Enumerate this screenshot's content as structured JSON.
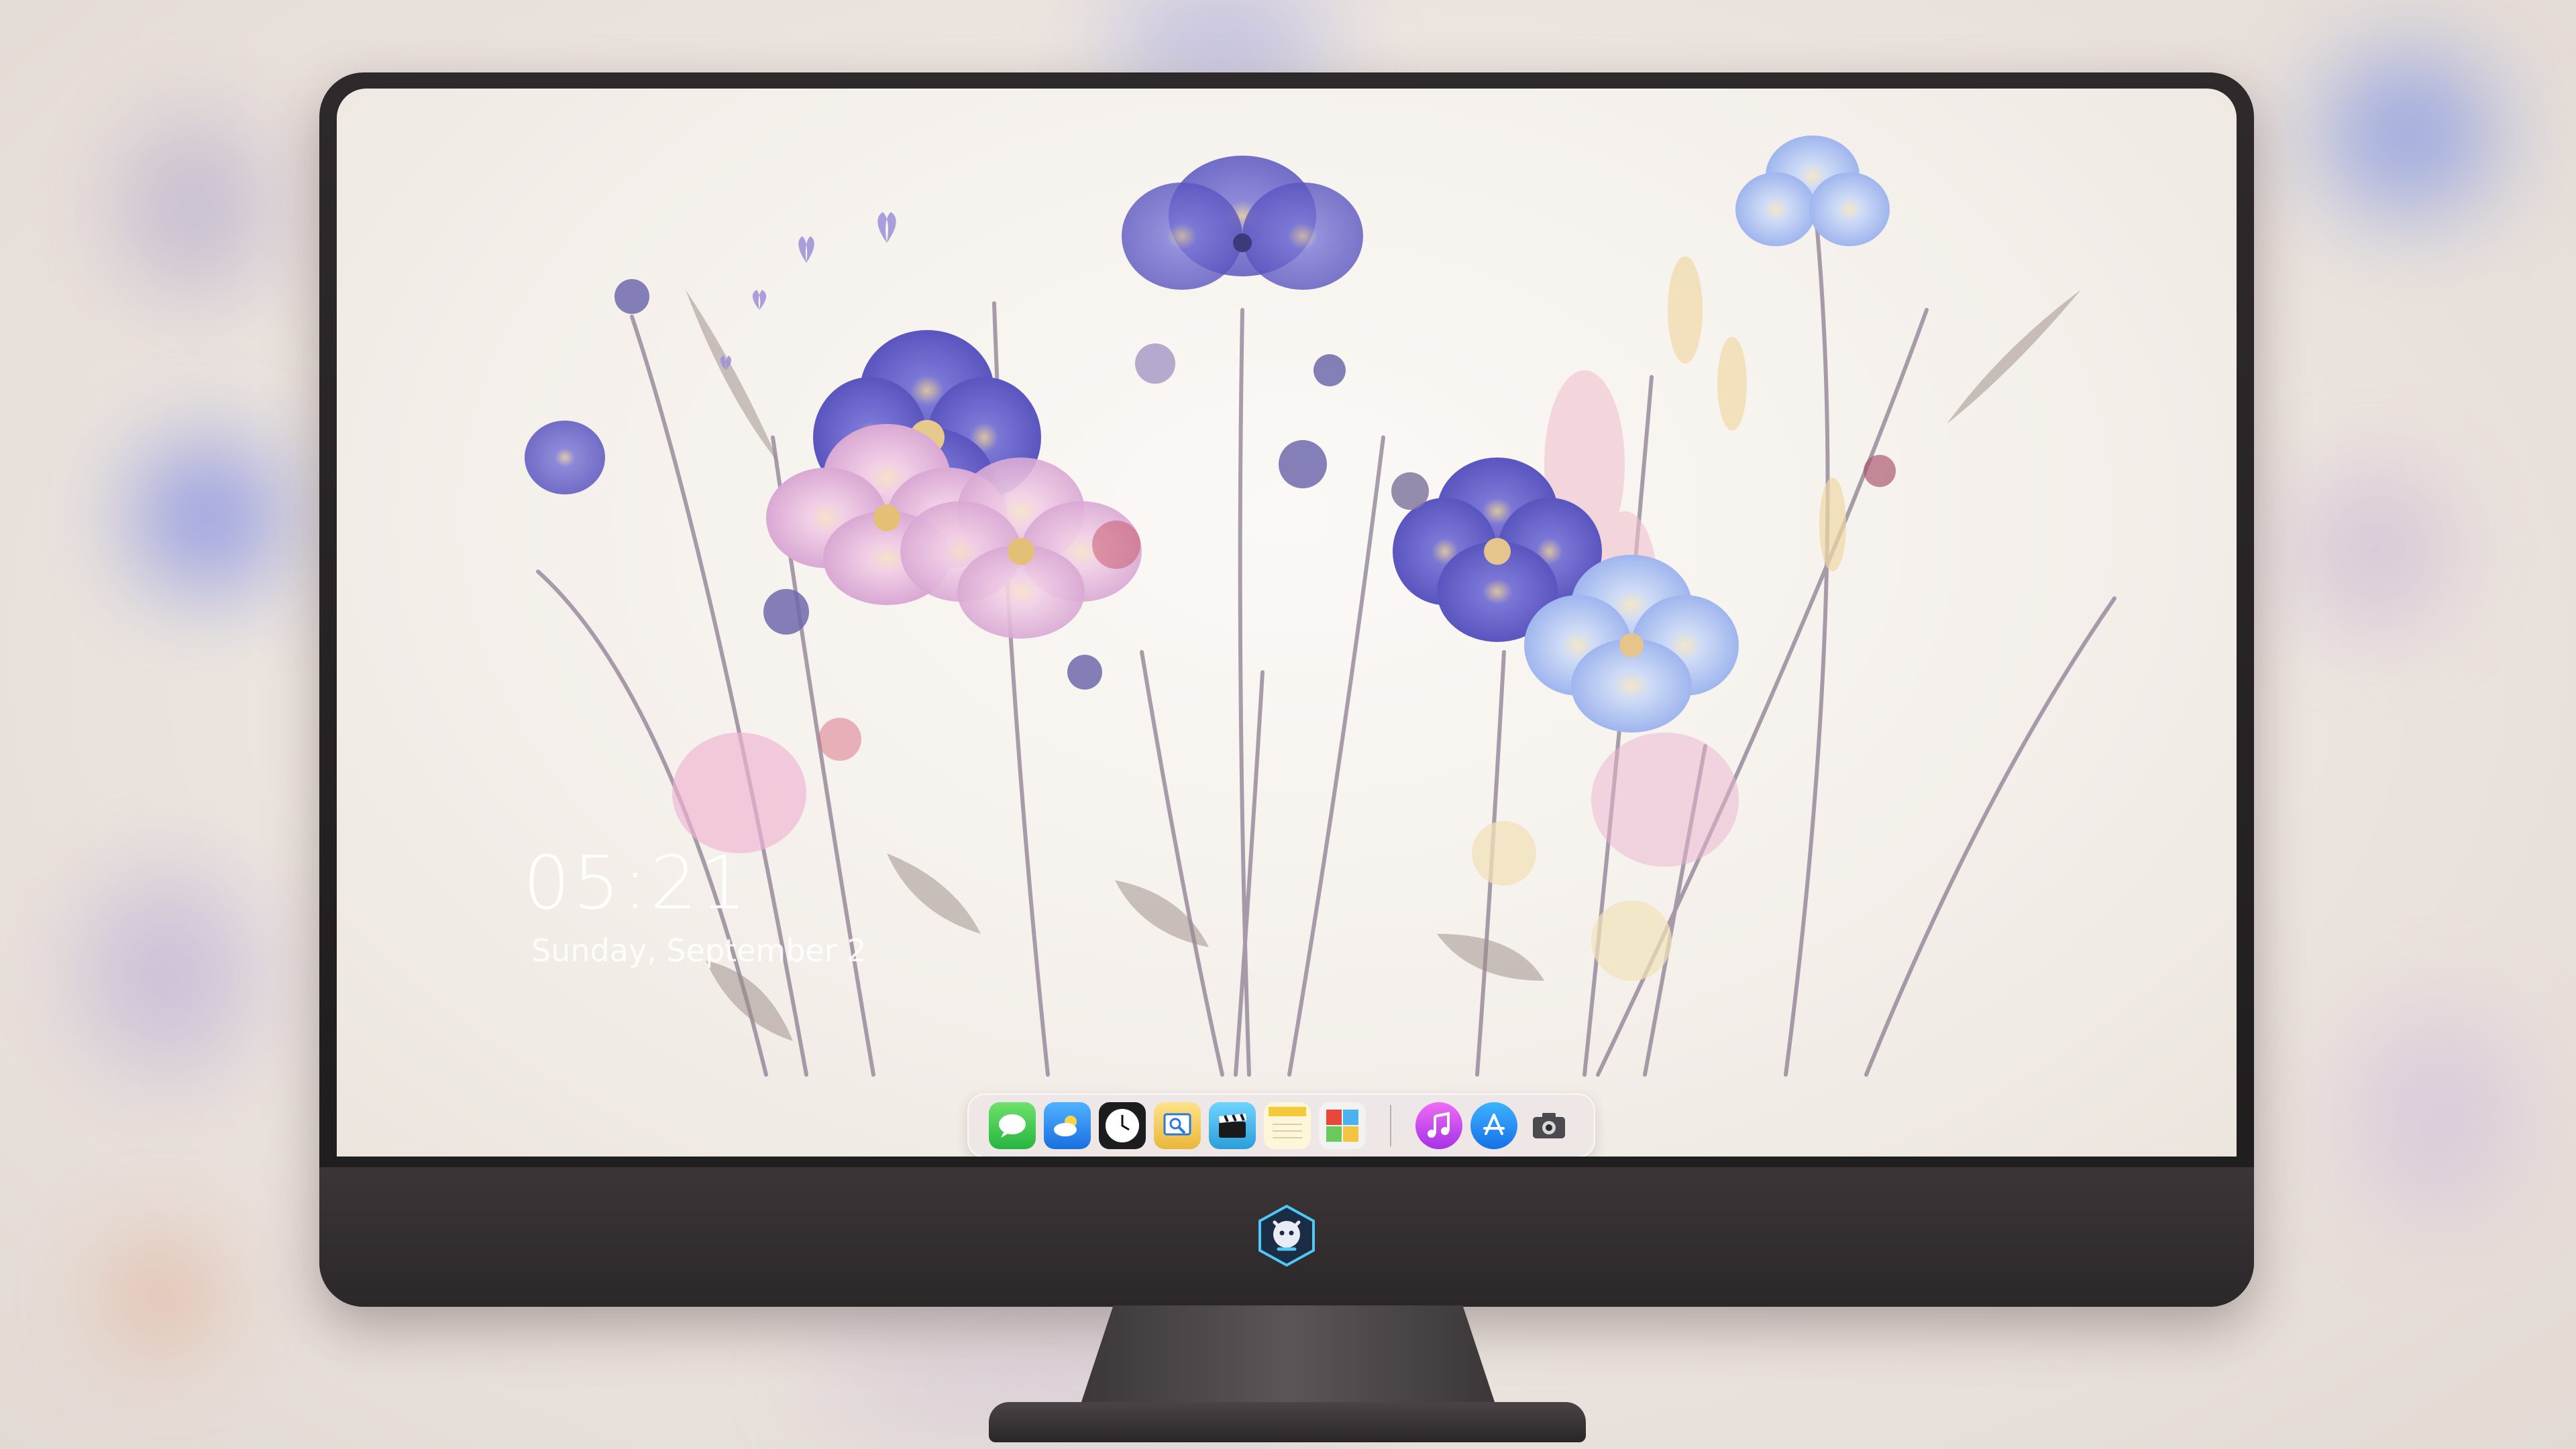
{
  "lockscreen": {
    "time": "05:21",
    "date": "Sunday, September 2"
  },
  "dock": {
    "apps": [
      {
        "name": "Messages",
        "icon": "messages-icon",
        "color": "#2fc84a"
      },
      {
        "name": "Weather",
        "icon": "weather-icon",
        "color": "#2d8ef0"
      },
      {
        "name": "Clock",
        "icon": "clock-icon",
        "color": "#1c1c1e"
      },
      {
        "name": "Preview",
        "icon": "preview-icon",
        "color": "#f2c94c"
      },
      {
        "name": "Final Cut",
        "icon": "clapperboard-icon",
        "color": "#3ab7e8"
      },
      {
        "name": "Notes",
        "icon": "notes-icon",
        "color": "#f7d54a"
      },
      {
        "name": "Photo Booth",
        "icon": "photo-booth-icon",
        "color": "#e8483c"
      },
      {
        "name": "iTunes",
        "icon": "music-icon",
        "color": "#c94ff0"
      },
      {
        "name": "App Store",
        "icon": "app-store-icon",
        "color": "#1d8df2"
      },
      {
        "name": "Screenshot",
        "icon": "camera-icon",
        "color": "#6e6e73"
      }
    ]
  },
  "colors": {
    "wallpaper": "#f5f0eb",
    "bezel": "#2a2527",
    "flower_blue": "#5a5fc8",
    "flower_pink": "#e9b7d8"
  }
}
